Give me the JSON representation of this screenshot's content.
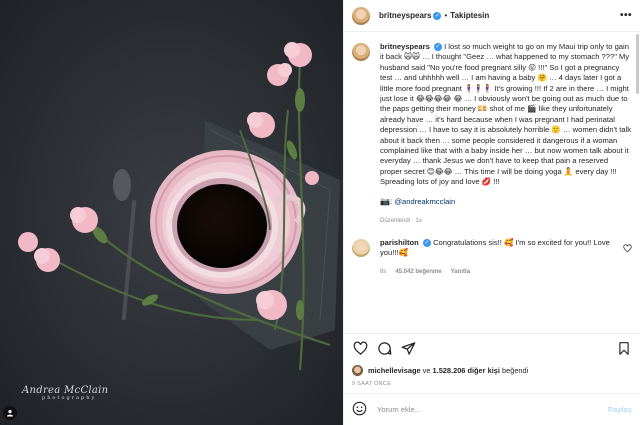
{
  "header": {
    "username": "britneyspears",
    "follow_label": "Takiptesin",
    "more_icon": "more-horizontal-icon"
  },
  "caption": {
    "username": "britneyspears",
    "text": "I lost so much weight to go on my Maui trip only to gain it back 🙀🙀 … I thought \"Geez … what happened to my stomach ???\" My husband said \"No you're food pregnant silly 😜 !!!\" So I got a pregnancy test … and uhhhhh well … I am having a baby 🤗 … 4 days later I got a little more food pregnant 🧍‍♀️🧍‍♀️🧍‍♀️ It's growing !!! If 2 are in there … I might just lose it 😂😂😂😂 😂 … I obviously won't be going out as much due to the paps getting their money 💴 shot of me 🎬 like they unfortunately already have … it's hard because when I was pregnant I had perinatal depression … I have to say it is absolutely horrible 🙂 … women didn't talk about it back then … some people considered it dangerous if a woman complained like that with a baby inside her … but now women talk about it everyday … thank Jesus we don't have to keep that pain a reserved proper secret 😊😂😂 … This time I will be doing yoga 🧘 every day !!! Spreading lots of joy and love 💋 !!!",
    "photographer_prefix": "📷:",
    "photographer_handle": "@andreakmcclain",
    "edited_label": "Düzenlendi",
    "edited_dot": "·",
    "edited_age": "1s"
  },
  "comment": {
    "username": "parishilton",
    "text": "Congratulations sis!! 🥰 I'm so excited for you!! Love you!!!🥰",
    "age": "8s",
    "likes": "45.042 beğenme",
    "reply_label": "Yanıtla"
  },
  "likes": {
    "first_user": "michellevisage",
    "connector": "ve",
    "count": "1.528.206 diğer kişi",
    "suffix": "beğendi"
  },
  "timestamp": "9 SAAT ÖNCE",
  "add_comment": {
    "placeholder": "Yorum ekle...",
    "post_label": "Paylaş"
  },
  "watermark": {
    "name": "Andrea McClain",
    "sub": "photography"
  },
  "colors": {
    "link": "#00376b",
    "verified": "#3897f0",
    "post_disabled": "#b2dffc",
    "muted": "#8e8e8e"
  }
}
